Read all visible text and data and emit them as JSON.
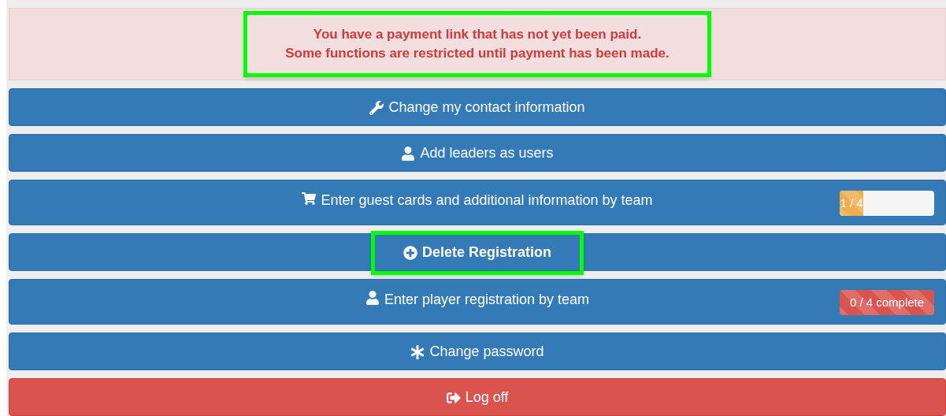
{
  "alert": {
    "lines": [
      "You have a payment link that has not yet been paid.",
      "Some functions are restricted until payment has been made."
    ],
    "highlighted": true
  },
  "buttons": [
    {
      "label": "Change my contact information",
      "kind": "primary",
      "highlighted": false
    },
    {
      "label": "Add leaders as users",
      "kind": "primary",
      "highlighted": false
    },
    {
      "label": "Enter guest cards and additional information by team",
      "kind": "primary",
      "highlighted": false,
      "progress": {
        "label": "1 / 4",
        "level": 0.25,
        "color": "#f0ad4e"
      }
    },
    {
      "label": "Delete Registration",
      "kind": "primary",
      "highlighted": true
    },
    {
      "label": "Enter player registration by team",
      "kind": "primary",
      "highlighted": false,
      "progress": {
        "label": "0 / 4 complete",
        "level": 1,
        "color": "#d9534f"
      }
    },
    {
      "label": "Change password",
      "kind": "primary",
      "highlighted": false
    },
    {
      "label": "Log off",
      "kind": "danger",
      "highlighted": false
    }
  ]
}
